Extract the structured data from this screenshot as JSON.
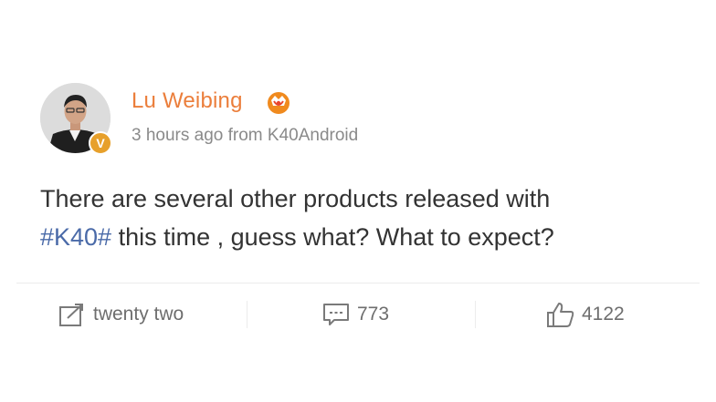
{
  "post": {
    "author": "Lu Weibing",
    "verified_badge": "V",
    "meta": "3 hours ago from K40Android",
    "content": {
      "line1": "There are several other products released with",
      "hashtag": "#K40#",
      "line2_rest": " this time , guess what? What to expect?"
    },
    "actions": {
      "repost": "twenty two",
      "comments": "773",
      "likes": "4122"
    }
  },
  "colors": {
    "author": "#eb7e3b",
    "hashtag": "#4a6aa8",
    "text": "#333333",
    "meta": "#8a8a8a",
    "badge": "#e7a02b"
  },
  "icons": {
    "vip": "vip-crown-icon",
    "repost": "repost-icon",
    "comment": "comment-icon",
    "like": "like-icon"
  }
}
